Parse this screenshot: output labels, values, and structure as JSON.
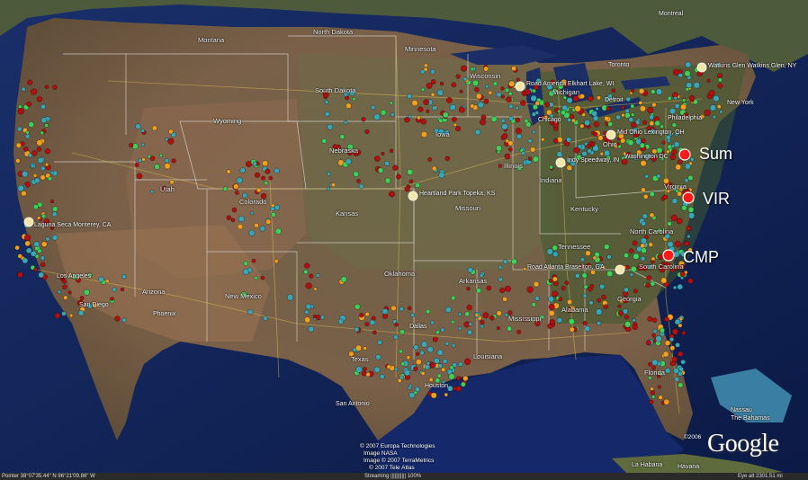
{
  "map": {
    "type": "satellite-overlay",
    "region": "contiguous United States",
    "colors": {
      "ocean": "#0f2452",
      "land": "#6b5a45",
      "state_border": "#e8e8e8",
      "roads": "#e0c050",
      "callout_marker": "#ff1a1a",
      "point_green": "#3fcf5a",
      "point_teal": "#3aa6b5",
      "point_red": "#b01010",
      "point_orange": "#f0a020"
    },
    "states": [
      "North Dakota",
      "Montana",
      "Minnesota",
      "South Dakota",
      "Wisconsin",
      "Wyoming",
      "Iowa",
      "Nebraska",
      "Michigan",
      "Ohio",
      "Illinois",
      "Indiana",
      "Utah",
      "Colorado",
      "Kansas",
      "Missouri",
      "Kentucky",
      "Virginia",
      "North Carolina",
      "Tennessee",
      "South Carolina",
      "Oklahoma",
      "Arkansas",
      "New Mexico",
      "Arizona",
      "Georgia",
      "Alabama",
      "Mississippi",
      "Texas",
      "Louisiana",
      "Florida"
    ],
    "cities": [
      "Montreal",
      "Toronto",
      "Chicago",
      "Detroit",
      "New York",
      "Philadelphia",
      "Washington DC",
      "Los Angeles",
      "San Diego",
      "Phoenix",
      "Dallas",
      "Houston",
      "San Antonio",
      "La Habana",
      "Havana",
      "Nassau",
      "The Bahamas"
    ],
    "tracks": [
      "Watkins Glen Watkins Glen, NY",
      "Road America Elkhart Lake, WI",
      "Mid Ohio Lexington, OH",
      "Indy Speedway, IN",
      "Heartland Park Topeka, KS",
      "Road Atlanta Braselton, GA",
      "Laguna Seca Monterey, CA"
    ],
    "callouts": [
      {
        "label": "Sum",
        "icon": "red-dot-marker"
      },
      {
        "label": "VIR",
        "icon": "red-dot-marker"
      },
      {
        "label": "CMP",
        "icon": "red-dot-marker"
      }
    ]
  },
  "logo": {
    "text": "Google",
    "sup": "©2006"
  },
  "credits": {
    "line1": "© 2007 Europa Technologies",
    "line2": "Image NASA",
    "line3": "Image © 2007 TerraMetrics",
    "line4": "© 2007 Tele Atlas"
  },
  "status": {
    "pointer": "Pointer  38°07'35.44\" N  96°21'09.86\" W",
    "streaming": "Streaming ||||||||||| 100%",
    "eye": "Eye alt  2301.51 mi"
  }
}
